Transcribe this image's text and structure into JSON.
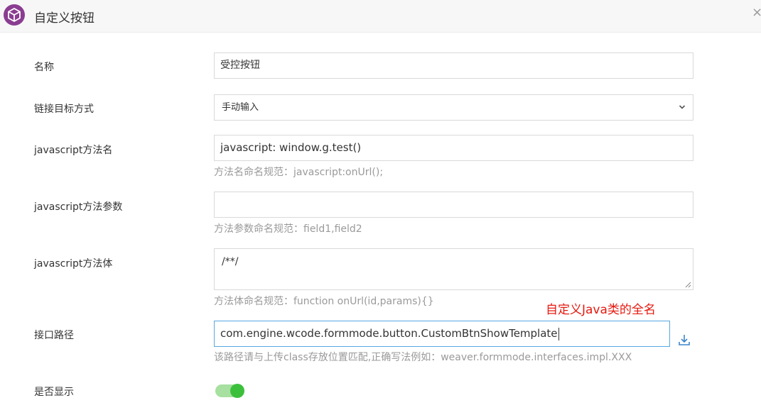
{
  "dialog": {
    "title": "自定义按钮",
    "close_glyph": "×",
    "accent_color": "#8a3d91"
  },
  "form": {
    "name": {
      "label": "名称",
      "value": "受控按钮"
    },
    "link_target": {
      "label": "链接目标方式",
      "selected": "手动输入"
    },
    "js_method_name": {
      "label": "javascript方法名",
      "value": "javascript: window.g.test()",
      "hint": "方法名命名规范：javascript:onUrl();"
    },
    "js_method_params": {
      "label": "javascript方法参数",
      "value": "",
      "hint": "方法参数命名规范：field1,field2"
    },
    "js_method_body": {
      "label": "javascript方法体",
      "value": "/**/",
      "hint": "方法体命名规范：function onUrl(id,params){}"
    },
    "interface_path": {
      "label": "接口路径",
      "value": "com.engine.wcode.formmode.button.CustomBtnShowTemplate",
      "hint": "该路径请与上传class存放位置匹配,正确写法例如：weaver.formmode.interfaces.impl.XXX",
      "annotation": "自定义Java类的全名",
      "annotation_color": "#e5190f",
      "upload_icon": "upload-icon"
    },
    "show": {
      "label": "是否显示",
      "on": true,
      "on_color": "#3cc03c"
    }
  }
}
